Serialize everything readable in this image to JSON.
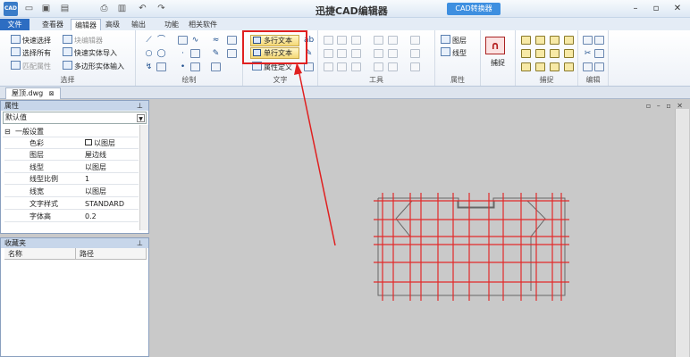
{
  "titlebar": {
    "app_title": "迅捷CAD编辑器",
    "badge": "CAD转换器",
    "logo": "CAD",
    "quick_access_icons": [
      "open-folder-icon",
      "save-icon",
      "print-icon",
      "undo-icon",
      "redo-icon"
    ],
    "window_buttons": [
      "minimize-icon",
      "restore-icon",
      "close-icon"
    ]
  },
  "menu": {
    "tabs": [
      "文件",
      "查看器",
      "编辑器",
      "高级",
      "输出",
      "功能",
      "相关软件"
    ],
    "active": "编辑器"
  },
  "ribbon": {
    "select": {
      "label": "选择",
      "items": [
        {
          "text": "快速选择",
          "enabled": true
        },
        {
          "text": "块编辑器",
          "enabled": false
        },
        {
          "text": "选择所有",
          "enabled": true
        },
        {
          "text": "快速实体导入",
          "enabled": true
        },
        {
          "text": "匹配属性",
          "enabled": false
        },
        {
          "text": "多边形实体输入",
          "enabled": true
        }
      ]
    },
    "draw": {
      "label": "绘制"
    },
    "text": {
      "label": "文字",
      "multiline": "多行文本",
      "singleline": "单行文本",
      "attribute_def": "属性定义"
    },
    "tools": {
      "label": "工具"
    },
    "properties": {
      "label": "属性",
      "layer": "图层",
      "linetype": "线型"
    },
    "capture": {
      "label": "捕捉",
      "button": "捕捉"
    },
    "edit": {
      "label": "编辑"
    }
  },
  "document": {
    "tab": "屋顶.dwg"
  },
  "props_panel": {
    "title": "属性",
    "select_value": "默认值",
    "section": "一般设置",
    "rows": [
      {
        "key": "色彩",
        "value": "以图层"
      },
      {
        "key": "图层",
        "value": "屋边线"
      },
      {
        "key": "线型",
        "value": "以图层"
      },
      {
        "key": "线型比例",
        "value": "1"
      },
      {
        "key": "线宽",
        "value": "以图层"
      },
      {
        "key": "文字样式",
        "value": "STANDARD"
      },
      {
        "key": "字体高",
        "value": "0.2"
      }
    ]
  },
  "favorites": {
    "title": "收藏夹",
    "columns": [
      "名称",
      "路径"
    ]
  },
  "colors": {
    "accent": "#2d6dc2",
    "highlight": "#e02020",
    "drawing_red": "#e32a2a"
  }
}
